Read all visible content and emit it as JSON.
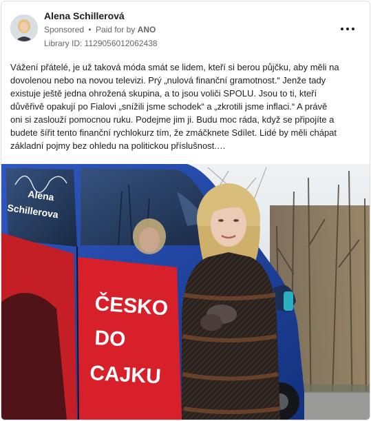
{
  "ad": {
    "page_name": "Alena Schillerová",
    "sponsored_label": "Sponsored",
    "separator": "•",
    "paid_for_prefix": "Paid for by",
    "paid_for_name": "ANO",
    "library_id": "Library ID: 1129056012062438",
    "more_icon": "more-horizontal-icon",
    "body": "Vážení přátelé, je už taková móda smát se lidem, kteří si berou půjčku, aby měli na\ndovolenou nebo na novou televizi. Prý „nulová finanční gramotnost.“ Jenže tady\nexistuje ještě jedna ohrožená skupina, a to jsou voliči SPOLU. Jsou to ti, kteří\ndůvěřivě opakují po Fialovi „snížili jsme schodek“ a „zkrotili jsme inflaci.“ A právě\noni si zaslouží pomocnou ruku. Podejme jim ji. Budu moc ráda, když se připojíte a\nbudete šířit tento finanční rychlokurz tím, že zmáčknete Sdílet. Lidé by měli chápat\nzákladní pojmy bez ohledu na politickou příslušnost.…"
  },
  "creative": {
    "van_signature_text": "Alena Schillerova",
    "van_slogan_line1": "ČESKO",
    "van_slogan_line2": "DO",
    "van_slogan_line3": "CAJKU",
    "colors": {
      "van_blue": "#1b3f9e",
      "van_red": "#d8202a",
      "sky": "#e7ecef",
      "coat": "#2a211d"
    }
  }
}
